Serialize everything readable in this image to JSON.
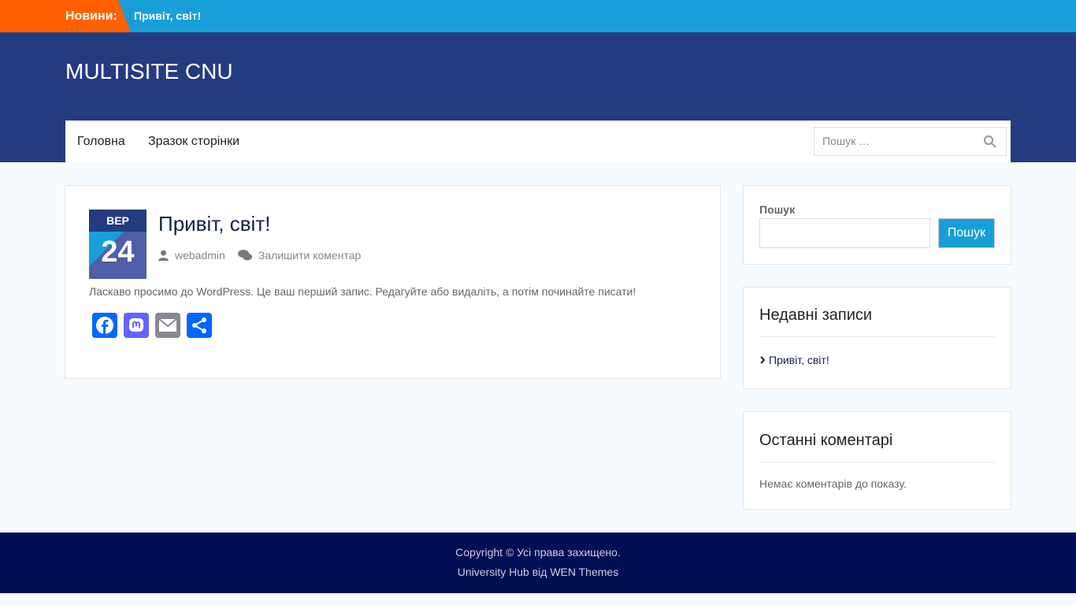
{
  "topbar": {
    "label": "Новини:",
    "item": "Привіт, світ!"
  },
  "header": {
    "site_title": "MULTISITE CNU"
  },
  "nav": {
    "items": [
      "Головна",
      "Зразок сторінки"
    ],
    "search_placeholder": "Пошук …"
  },
  "post": {
    "month": "ВЕР",
    "day": "24",
    "title": "Привіт, світ!",
    "author": "webadmin",
    "comment_link": "Залишити коментар",
    "excerpt": "Ласкаво просимо до WordPress. Це ваш перший запис. Редагуйте або видаліть, а потім починайте писати!"
  },
  "sidebar": {
    "search_label": "Пошук",
    "search_button": "Пошук",
    "recent_title": "Недавні записи",
    "recent_items": [
      "Привіт, світ!"
    ],
    "comments_title": "Останні коментарі",
    "comments_empty": "Немає коментарів до показу."
  },
  "footer": {
    "copyright": "Copyright © Усі права захищено.",
    "credit": "University Hub від WEN Themes"
  }
}
